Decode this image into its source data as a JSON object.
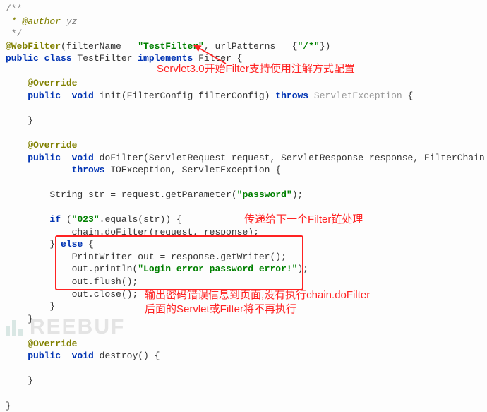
{
  "code": {
    "c_open": "/**",
    "c_author_tag": " * @author",
    "c_author_name": " yz",
    "c_close": " */",
    "a_webfilter": "@WebFilter",
    "wf_args_a": "(filterName = ",
    "wf_name": "\"TestFilter\"",
    "wf_args_b": ", urlPatterns = {",
    "wf_pattern": "\"/*\"",
    "wf_args_c": "})",
    "k_public": "public ",
    "k_class": "class",
    "cls_name": " TestFilter ",
    "k_implements": "implements",
    "iface": " Filter {",
    "a_override": "@Override",
    "k_void": " void",
    "m_init_sig": " init(FilterConfig filterConfig) ",
    "k_throws": "throws",
    "exc_servlet": " ServletException",
    "m_dofilter_sig": " doFilter(ServletRequest request, ServletResponse response, FilterChain chain)",
    "exc_both": " IOException, ServletException {",
    "l_str": "String str = request.getParameter(",
    "s_password": "\"password\"",
    "l_str_end": ");",
    "k_if": "if ",
    "if_cond_a": "(",
    "s_023": "\"023\"",
    "if_cond_b": ".equals(str)) {",
    "l_chain": "chain.doFilter(request, response);",
    "k_else": " else ",
    "l_out1": "PrintWriter out = response.getWriter();",
    "l_out2a": "out.println(",
    "s_login_err": "\"Login error password error!\"",
    "l_out2b": ");",
    "l_flush": "out.flush();",
    "l_close": "out.close();",
    "m_destroy_sig": " destroy() {",
    "brace_open": " {",
    "brace_close": "}",
    "brace_close_s": "}"
  },
  "annotations": {
    "note1": "Servlet3.0开始Filter支持使用注解方式配置",
    "note2": "传递给下一个Filter链处理",
    "note3a": "输出密码错误信息到页面,没有执行chain.doFilter",
    "note3b": "后面的Servlet或Filter将不再执行"
  },
  "watermark": "REEBUF"
}
